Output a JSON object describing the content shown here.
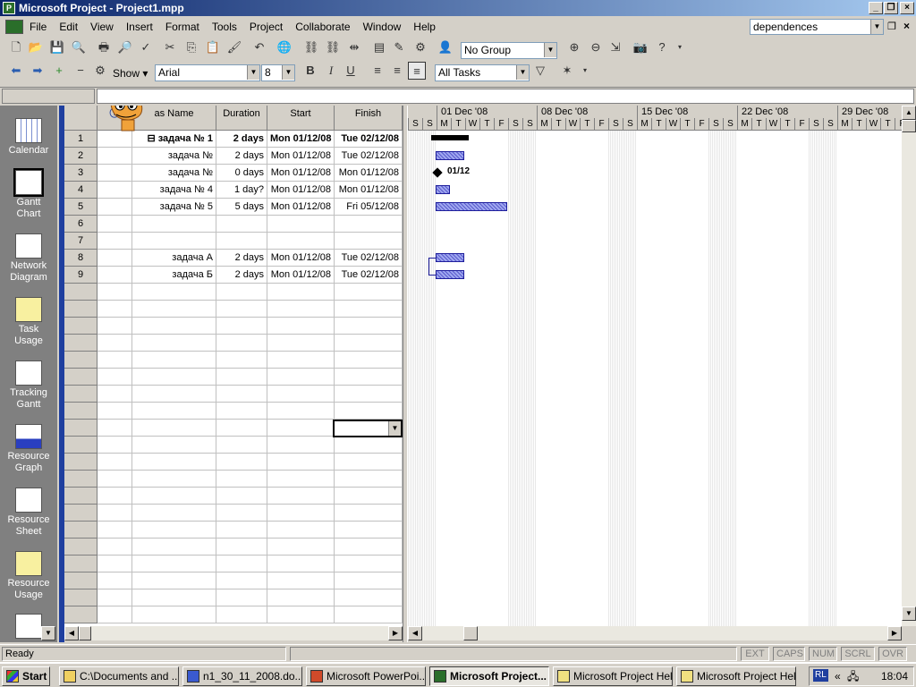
{
  "window": {
    "title": "Microsoft Project - Project1.mpp"
  },
  "menu": [
    "File",
    "Edit",
    "View",
    "Insert",
    "Format",
    "Tools",
    "Project",
    "Collaborate",
    "Window",
    "Help"
  ],
  "help_search": "dependences",
  "toolbar": {
    "group": "No Group",
    "show_label": "Show",
    "font": "Arial",
    "font_size": "8",
    "filter": "All Tasks"
  },
  "views": [
    "Calendar",
    "Gantt Chart",
    "Network Diagram",
    "Task Usage",
    "Tracking Gantt",
    "Resource Graph",
    "Resource Sheet",
    "Resource Usage"
  ],
  "table": {
    "headers": {
      "info": "i",
      "name": "Name",
      "name_prefix": "as",
      "duration": "Duration",
      "start": "Start",
      "finish": "Finish"
    },
    "rows": [
      {
        "id": "1",
        "name": "задача № 1",
        "duration": "2 days",
        "start": "Mon 01/12/08",
        "finish": "Tue 02/12/08",
        "summary": true
      },
      {
        "id": "2",
        "name": "задача №",
        "duration": "2 days",
        "start": "Mon 01/12/08",
        "finish": "Tue 02/12/08"
      },
      {
        "id": "3",
        "name": "задача №",
        "duration": "0 days",
        "start": "Mon 01/12/08",
        "finish": "Mon 01/12/08"
      },
      {
        "id": "4",
        "name": "задача № 4",
        "duration": "1 day?",
        "start": "Mon 01/12/08",
        "finish": "Mon 01/12/08"
      },
      {
        "id": "5",
        "name": "задача № 5",
        "duration": "5 days",
        "start": "Mon 01/12/08",
        "finish": "Fri 05/12/08"
      },
      {
        "id": "6",
        "name": "",
        "duration": "",
        "start": "",
        "finish": ""
      },
      {
        "id": "7",
        "name": "",
        "duration": "",
        "start": "",
        "finish": ""
      },
      {
        "id": "8",
        "name": "задача А",
        "duration": "2 days",
        "start": "Mon 01/12/08",
        "finish": "Tue 02/12/08"
      },
      {
        "id": "9",
        "name": "задача Б",
        "duration": "2 days",
        "start": "Mon 01/12/08",
        "finish": "Tue 02/12/08"
      }
    ]
  },
  "gantt": {
    "weeks": [
      "01 Dec '08",
      "08 Dec '08",
      "15 Dec '08",
      "22 Dec '08",
      "29 Dec '08"
    ],
    "days": [
      "S",
      "S",
      "M",
      "T",
      "W",
      "T",
      "F",
      "S",
      "S",
      "M",
      "T",
      "W",
      "T",
      "F",
      "S",
      "S",
      "M",
      "T",
      "W",
      "T",
      "F",
      "S",
      "S",
      "M",
      "T",
      "W",
      "T",
      "F",
      "S",
      "S",
      "M",
      "T",
      "W",
      "T",
      "F"
    ],
    "milestone_label": "01/12"
  },
  "status": {
    "ready": "Ready",
    "indicators": [
      "EXT",
      "CAPS",
      "NUM",
      "SCRL",
      "OVR"
    ]
  },
  "taskbar": {
    "start": "Start",
    "items": [
      "C:\\Documents and ...",
      "n1_30_11_2008.do...",
      "Microsoft PowerPoi...",
      "Microsoft Project...",
      "Microsoft Project Help",
      "Microsoft Project Help"
    ],
    "lang": "RL",
    "clock": "18:04"
  }
}
